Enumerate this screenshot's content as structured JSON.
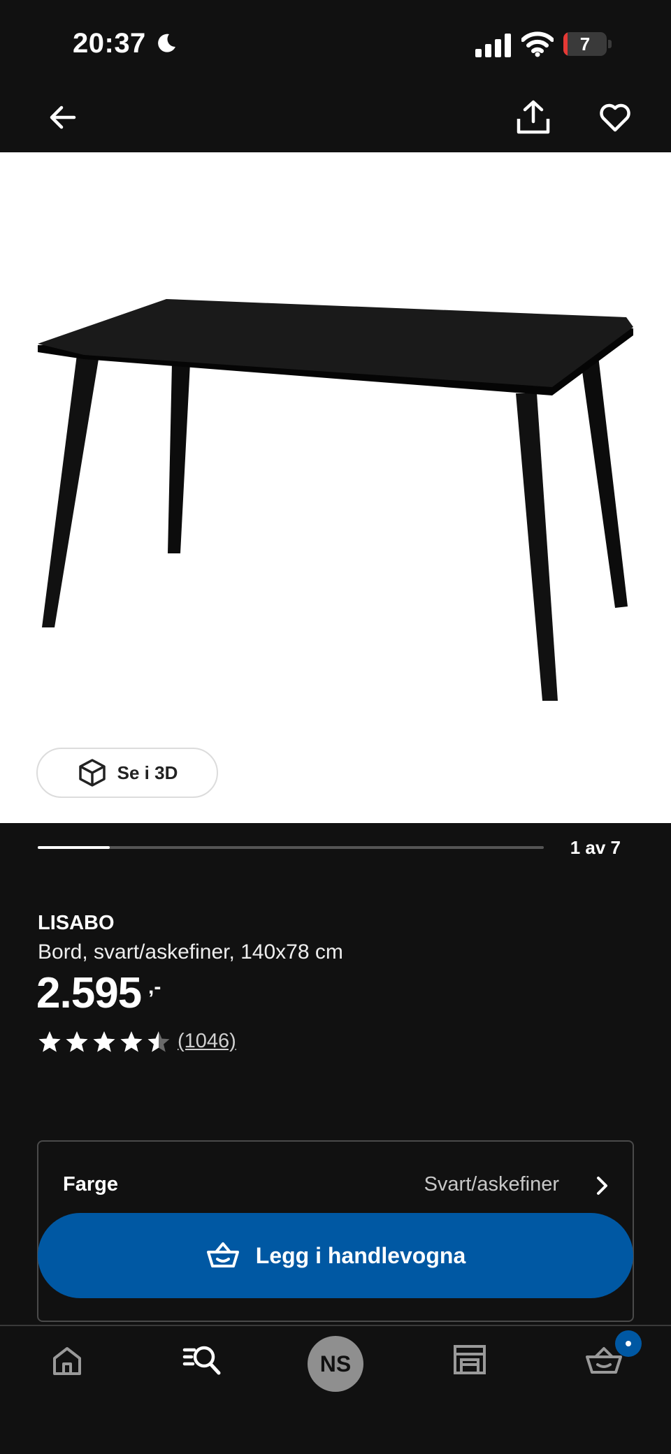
{
  "status_bar": {
    "time": "20:37",
    "battery_level": "7",
    "battery_fraction": 0.1,
    "icons": [
      "moon-icon",
      "signal-icon",
      "wifi-icon",
      "battery-icon"
    ]
  },
  "top_nav": {
    "icons": [
      "back-arrow-icon",
      "share-icon",
      "heart-icon"
    ]
  },
  "gallery": {
    "view_3d_label": "Se i 3D",
    "current_index": 1,
    "total": 7,
    "counter_text": "1 av 7"
  },
  "product": {
    "name": "LISABO",
    "description": "Bord, svart/askefiner, 140x78 cm",
    "price": "2.595",
    "price_suffix": ",-",
    "rating": 4.5,
    "review_count": "(1046)"
  },
  "options": {
    "color_label": "Farge",
    "color_value": "Svart/askefiner"
  },
  "cart_button": {
    "label": "Legg i handlevogna"
  },
  "bottom_nav": {
    "avatar_initials": "NS",
    "items": [
      "home-icon",
      "search-icon",
      "avatar",
      "store-icon",
      "cart-icon"
    ],
    "cart_badge": true
  },
  "colors": {
    "background": "#111111",
    "accent_blue": "#0058a3",
    "battery_low": "#e53935"
  }
}
